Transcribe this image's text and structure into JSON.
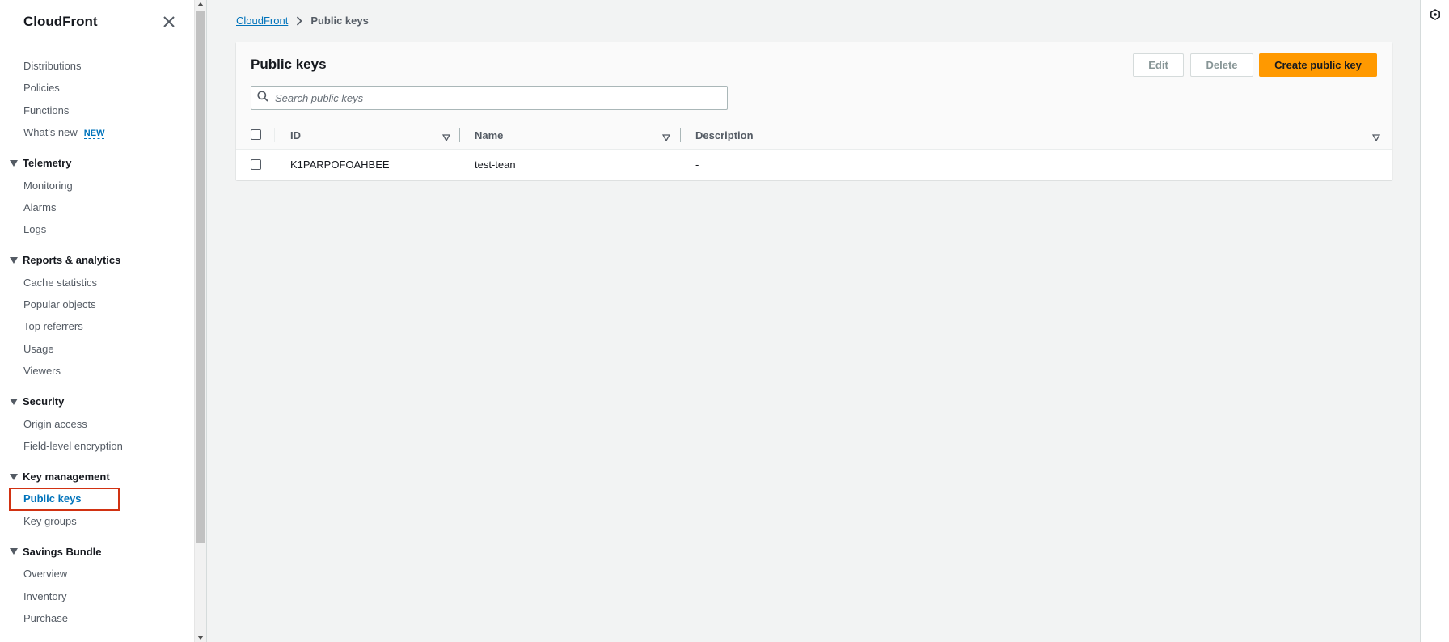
{
  "sidebar": {
    "title": "CloudFront",
    "items_top": [
      {
        "label": "Distributions"
      },
      {
        "label": "Policies"
      },
      {
        "label": "Functions"
      },
      {
        "label": "What's new",
        "badge": "NEW"
      }
    ],
    "sections": [
      {
        "label": "Telemetry",
        "items": [
          "Monitoring",
          "Alarms",
          "Logs"
        ]
      },
      {
        "label": "Reports & analytics",
        "items": [
          "Cache statistics",
          "Popular objects",
          "Top referrers",
          "Usage",
          "Viewers"
        ]
      },
      {
        "label": "Security",
        "items": [
          "Origin access",
          "Field-level encryption"
        ]
      },
      {
        "label": "Key management",
        "items": [
          "Public keys",
          "Key groups"
        ],
        "active": "Public keys"
      },
      {
        "label": "Savings Bundle",
        "items": [
          "Overview",
          "Inventory",
          "Purchase"
        ]
      }
    ]
  },
  "breadcrumb": {
    "root": "CloudFront",
    "current": "Public keys"
  },
  "panel": {
    "title": "Public keys",
    "edit_label": "Edit",
    "delete_label": "Delete",
    "create_label": "Create public key",
    "search_placeholder": "Search public keys"
  },
  "table": {
    "columns": [
      "ID",
      "Name",
      "Description"
    ],
    "rows": [
      {
        "id": "K1PARPOFOAHBEE",
        "name": "test-tean",
        "description": "-"
      }
    ]
  },
  "colors": {
    "accent": "#0073bb",
    "primary_button": "#ff9900",
    "highlight_box": "#d13212"
  }
}
